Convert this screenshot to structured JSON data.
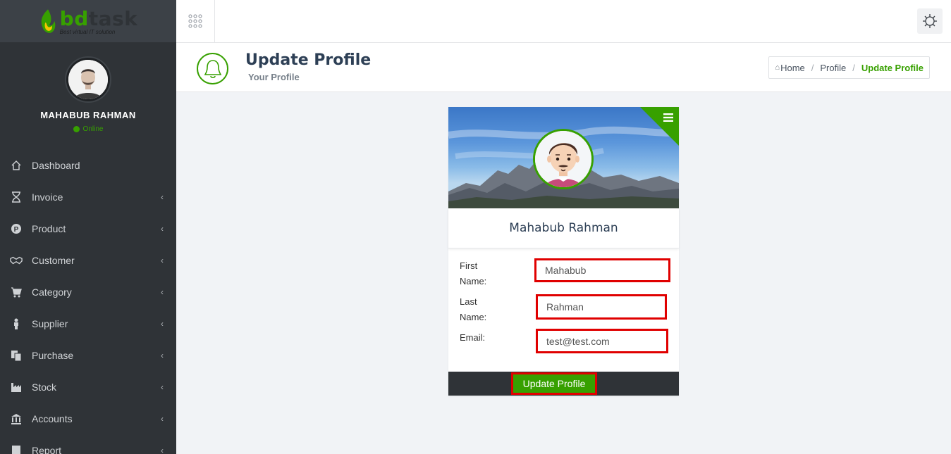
{
  "brand": {
    "name_part1": "bd",
    "name_part2": "task",
    "tagline": "Best virtual IT solution",
    "accent_color": "#37a000"
  },
  "user": {
    "name": "MAHABUB RAHMAN",
    "status": "Online"
  },
  "sidebar": {
    "items": [
      {
        "label": "Dashboard",
        "icon": "home-icon",
        "has_submenu": false
      },
      {
        "label": "Invoice",
        "icon": "hourglass-icon",
        "has_submenu": true
      },
      {
        "label": "Product",
        "icon": "product-icon",
        "has_submenu": true
      },
      {
        "label": "Customer",
        "icon": "handshake-icon",
        "has_submenu": true
      },
      {
        "label": "Category",
        "icon": "cart-icon",
        "has_submenu": true
      },
      {
        "label": "Supplier",
        "icon": "person-icon",
        "has_submenu": true
      },
      {
        "label": "Purchase",
        "icon": "copy-icon",
        "has_submenu": true
      },
      {
        "label": "Stock",
        "icon": "industry-icon",
        "has_submenu": true
      },
      {
        "label": "Accounts",
        "icon": "bank-icon",
        "has_submenu": true
      },
      {
        "label": "Report",
        "icon": "report-icon",
        "has_submenu": true
      }
    ],
    "chevron": "‹"
  },
  "header": {
    "title": "Update Profile",
    "subtitle": "Your Profile",
    "breadcrumb": {
      "home": "Home",
      "profile": "Profile",
      "current": "Update Profile",
      "separator": "/"
    }
  },
  "card": {
    "display_name": "Mahabub Rahman",
    "fields": {
      "first_name_label_1": "First",
      "first_name_label_2": "Name:",
      "first_name_value": "Mahabub",
      "last_name_label_1": "Last",
      "last_name_label_2": "Name:",
      "last_name_value": "Rahman",
      "email_label": "Email:",
      "email_value": "test@test.com"
    },
    "submit_label": "Update Profile"
  }
}
